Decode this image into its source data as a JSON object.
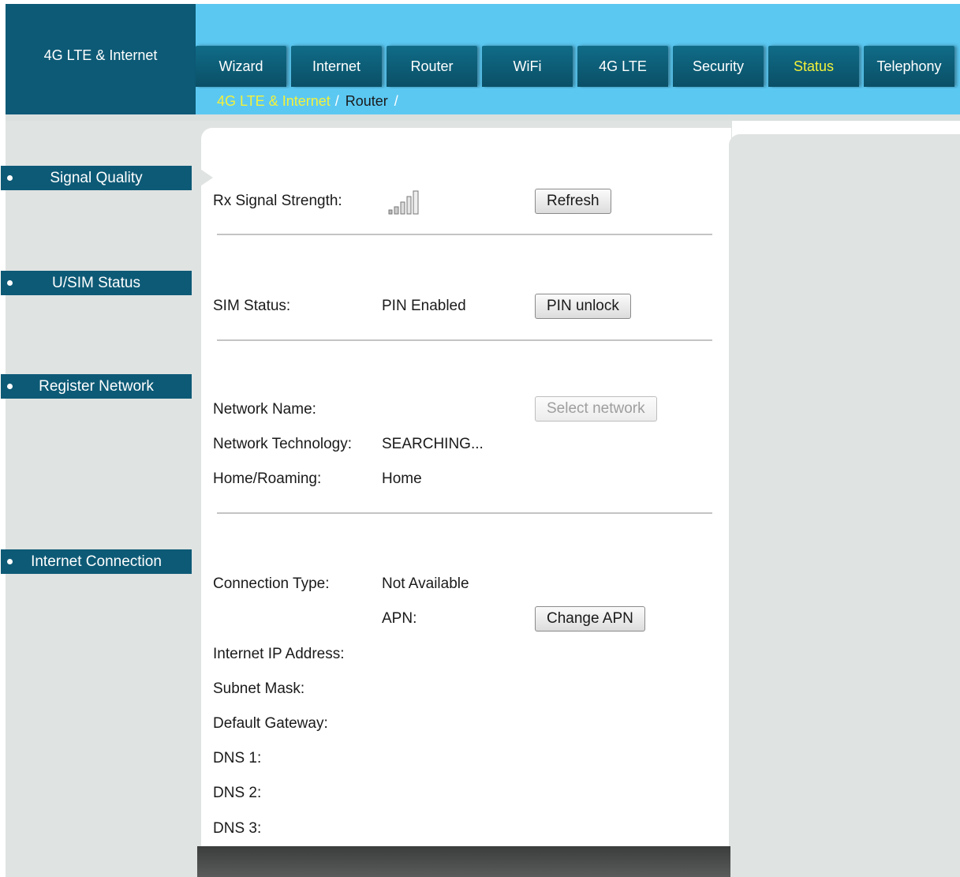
{
  "header": {
    "brand": "4G LTE & Internet",
    "tabs": [
      "Wizard",
      "Internet",
      "Router",
      "WiFi",
      "4G LTE",
      "Security",
      "Status",
      "Telephony"
    ],
    "active_tab": "Status"
  },
  "breadcrumb": {
    "root": "4G LTE & Internet",
    "separator": "/",
    "current": "Router"
  },
  "sidebar": {
    "items": [
      "Signal Quality",
      "U/SIM Status",
      "Register Network",
      "Internet Connection"
    ],
    "selected": "Signal Quality"
  },
  "signal_quality": {
    "rx_label": "Rx Signal Strength:",
    "signal_icon": "signal-bars-icon",
    "refresh_button": "Refresh"
  },
  "sim_status": {
    "label": "SIM Status:",
    "value": "PIN Enabled",
    "pin_unlock_button": "PIN unlock"
  },
  "register_network": {
    "network_name_label": "Network Name:",
    "network_name_value": "",
    "select_network_button": "Select network",
    "technology_label": "Network Technology:",
    "technology_value": "SEARCHING...",
    "roaming_label": "Home/Roaming:",
    "roaming_value": "Home"
  },
  "internet_connection": {
    "connection_type_label": "Connection Type:",
    "connection_type_value": "Not Available",
    "apn_label": "APN:",
    "change_apn_button": "Change APN",
    "ip_label": "Internet IP Address:",
    "subnet_label": "Subnet Mask:",
    "gateway_label": "Default Gateway:",
    "dns1_label": "DNS 1:",
    "dns2_label": "DNS 2:",
    "dns3_label": "DNS 3:"
  },
  "colors": {
    "header_dark": "#0d5a76",
    "header_light": "#5bc8f2",
    "active_tab_text": "#f3f13a",
    "panel_gray": "#dfe3e2"
  }
}
